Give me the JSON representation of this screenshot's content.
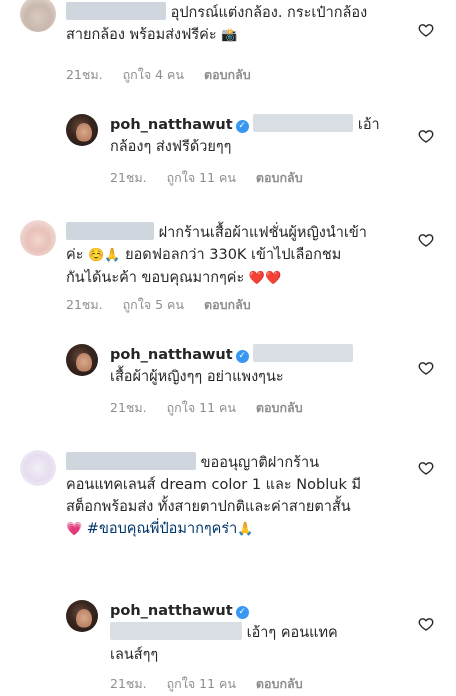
{
  "comments": [
    {
      "id": "c1",
      "type": "top",
      "text_line1": "อุปกรณ์แต่งกล้อง. กระเป๋ากล้อง",
      "text_line2": "สายกล้อง พร้อมส่งฟรีค่ะ",
      "emoji": "📸",
      "time": "21ชม.",
      "likes": "ถูกใจ 4 คน",
      "reply": "ตอบกลับ"
    },
    {
      "id": "r1",
      "type": "reply",
      "username": "poh_natthawut",
      "text_line1": "เอ้า",
      "text_line2": "กล้องๆ ส่งฟรีด้วยๆๆ",
      "time": "21ชม.",
      "likes": "ถูกใจ 11 คน",
      "reply": "ตอบกลับ"
    },
    {
      "id": "c2",
      "type": "top",
      "text_line1": "ฝากร้านเสื้อผ้าแฟชั่นผู้หญิงนำเข้า",
      "text_line2_a": "ค่ะ",
      "text_line2_emoji": "☺️🙏",
      "text_line2_b": "ยอดฟอลกว่า 330K เข้าไปเลือกชม",
      "text_line3": "กันได้นะค้า ขอบคุณมากๆค่ะ",
      "text_line3_emoji": "❤️❤️",
      "time": "21ชม.",
      "likes": "ถูกใจ 5 คน",
      "reply": "ตอบกลับ"
    },
    {
      "id": "r2",
      "type": "reply",
      "username": "poh_natthawut",
      "text_line2": "เสื้อผ้าผู้หญิงๆๆ อย่าแพงๆนะ",
      "time": "21ชม.",
      "likes": "ถูกใจ 11 คน",
      "reply": "ตอบกลับ"
    },
    {
      "id": "c3",
      "type": "top",
      "text_line1": "ขออนุญาติฝากร้าน",
      "text_line2": "คอนแทคเลนส์ dream color 1 และ Nobluk มี",
      "text_line3": "สต็อกพร้อมส่ง ทั้งสายตาปกติและค่าสายตาสั้น",
      "text_line4_emoji": "💗",
      "hashtag": "#ขอบคุณพี่ป๋อมากๆคร่า",
      "text_line4_emoji2": "🙏",
      "time": "",
      "likes": "",
      "reply": ""
    },
    {
      "id": "r3",
      "type": "reply",
      "username": "poh_natthawut",
      "text_line1": "เอ้าๆ คอนแทค",
      "text_line2": "เลนส์ๆๆ",
      "time": "21ชม.",
      "likes": "ถูกใจ 11 คน",
      "reply": "ตอบกลับ"
    }
  ],
  "colors": {
    "text": "#262626",
    "meta": "#8e8e8e",
    "verified": "#3897f0",
    "hashtag": "#003569"
  }
}
